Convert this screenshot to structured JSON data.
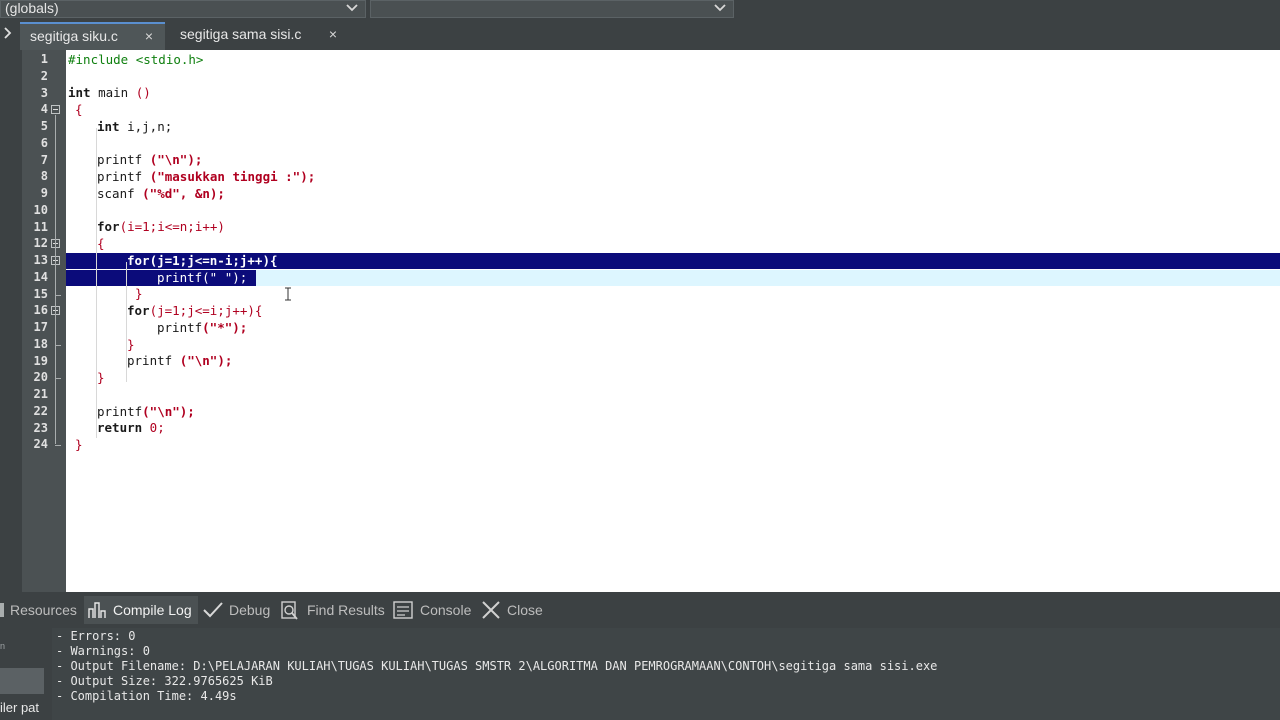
{
  "toolbar": {
    "scope_combo": "(globals)",
    "member_combo": ""
  },
  "tabs": [
    {
      "label": "segitiga siku.c",
      "active": true
    },
    {
      "label": "segitiga sama sisi.c",
      "active": false
    }
  ],
  "tab_close_glyph": "×",
  "line_numbers": [
    "1",
    "2",
    "3",
    "4",
    "5",
    "6",
    "7",
    "8",
    "9",
    "10",
    "11",
    "12",
    "13",
    "14",
    "15",
    "16",
    "17",
    "18",
    "19",
    "20",
    "21",
    "22",
    "23",
    "24"
  ],
  "code": {
    "l1": "#include <stdio.h>",
    "l3_kw": "int",
    "l3_rest": " main ",
    "l3_paren": "()",
    "l4": "{",
    "l5_kw": "int",
    "l5_rest": " i,j,n;",
    "l7_fn": "printf ",
    "l7_str": "(\"\\n\");",
    "l8_fn": "printf ",
    "l8_str": "(\"masukkan tinggi :\");",
    "l9_fn": "scanf ",
    "l9_str": "(\"%d\", &n);",
    "l11_kw": "for",
    "l11_rest": "(i=1;i<=n;i++)",
    "l12": "{",
    "l13": "for(j=1;j<=n-i;j++){",
    "l14": "printf(\" \");",
    "l15": "}",
    "l16_kw": "for",
    "l16_rest": "(j=1;j<=i;j++){",
    "l17_fn": "printf",
    "l17_str": "(\"*\");",
    "l18": "}",
    "l19_fn": "printf ",
    "l19_str": "(\"\\n\");",
    "l20": "}",
    "l22_fn": "printf",
    "l22_str": "(\"\\n\");",
    "l23_kw": "return",
    "l23_num": " 0;",
    "l24": "}"
  },
  "bottom_tabs": {
    "resources": "Resources",
    "compile_log": "Compile Log",
    "debug": "Debug",
    "find_results": "Find Results",
    "console": "Console",
    "close": "Close"
  },
  "left_panel": {
    "small_text": "n",
    "label": "iler pat"
  },
  "compile_log": [
    "- Errors: 0",
    "- Warnings: 0",
    "- Output Filename: D:\\PELAJARAN KULIAH\\TUGAS KULIAH\\TUGAS SMSTR 2\\ALGORITMA DAN PEMROGRAMAAN\\CONTOH\\segitiga sama sisi.exe",
    "- Output Size: 322.9765625 KiB",
    "- Compilation Time: 4.49s"
  ],
  "colors": {
    "selection": "#0b0b7a",
    "caret_line": "#ddf6ff",
    "string": "#b00020",
    "preprocessor": "#108010"
  }
}
